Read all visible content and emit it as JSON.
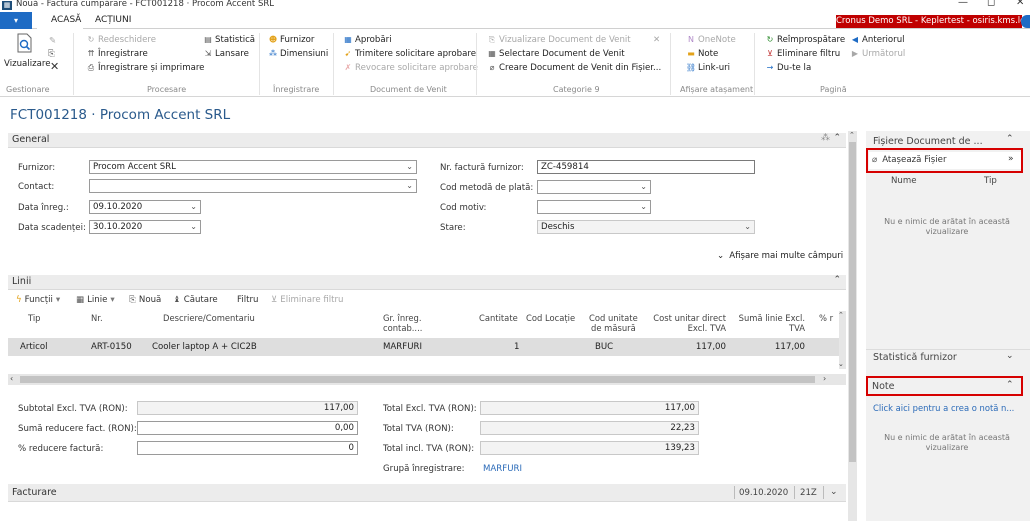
{
  "window": {
    "title": "Nouă - Factura cumpărare - FCT001218 · Procom Accent SRL",
    "app_icon_label": "nav",
    "controls": [
      "—",
      "◻",
      "✕"
    ]
  },
  "tabs": {
    "menu_icon": "chevron-down-icon",
    "items": [
      "ACASĂ",
      "ACȚIUNI"
    ],
    "company": "Cronus Demo SRL - Keplertest - osiris.kms.local"
  },
  "ribbon": {
    "groups": [
      {
        "label": "Gestionare"
      },
      {
        "label": "Procesare"
      },
      {
        "label": "Înregistrare"
      },
      {
        "label": "Document de Venit"
      },
      {
        "label": "Categorie 9"
      },
      {
        "label": "Afișare atașament"
      },
      {
        "label": "Pagină"
      }
    ],
    "vizualizare": "Vizualizare",
    "redeschidere": "Redeschidere",
    "inregistrare": "Înregistrare",
    "inregistrare_imprimare": "Înregistrare și imprimare",
    "statistica": "Statistică",
    "lansare": "Lansare",
    "furnizor": "Furnizor",
    "dimensiuni": "Dimensiuni",
    "aprobari": "Aprobări",
    "trimitere": "Trimitere solicitare aprobare",
    "revocare": "Revocare solicitare aprobare",
    "viz_doc_venit": "Vizualizare Document de Venit",
    "selectare_doc_venit": "Selectare Document de Venit",
    "creare_doc_venit": "Creare Document de Venit din Fișier...",
    "onenote": "OneNote",
    "note": "Note",
    "linkuri": "Link-uri",
    "reimprospatare": "Reîmprospătare",
    "eliminare_filtru": "Eliminare filtru",
    "du_te_la": "Du-te la",
    "anteriorul": "Anteriorul",
    "urmatorul": "Următorul"
  },
  "page": {
    "title": "FCT001218 · Procom Accent SRL"
  },
  "general": {
    "header": "General",
    "furnizor_label": "Furnizor:",
    "furnizor_value": "Procom Accent SRL",
    "contact_label": "Contact:",
    "contact_value": "",
    "data_inreg_label": "Data înreg.:",
    "data_inreg_value": "09.10.2020",
    "data_scad_label": "Data scadenței:",
    "data_scad_value": "30.10.2020",
    "nr_factura_label": "Nr. factură furnizor:",
    "nr_factura_value": "ZC-459814",
    "cod_metoda_label": "Cod metodă de plată:",
    "cod_metoda_value": "",
    "cod_motiv_label": "Cod motiv:",
    "cod_motiv_value": "",
    "stare_label": "Stare:",
    "stare_value": "Deschis",
    "show_more": "Afișare mai multe câmpuri"
  },
  "linii": {
    "header": "Linii",
    "toolbar": {
      "functii": "Funcții",
      "linie": "Linie",
      "noua": "Nouă",
      "cautare": "Căutare",
      "filtru": "Filtru",
      "eliminare_filtru": "Eliminare filtru"
    },
    "columns": {
      "tip": "Tip",
      "nr": "Nr.",
      "descriere": "Descriere/Comentariu",
      "gr_inreg_1": "Gr. înreg.",
      "gr_inreg_2": "contab....",
      "cantitate": "Cantitate",
      "cod_locatie": "Cod Locație",
      "cod_unitate_1": "Cod unitate",
      "cod_unitate_2": "de măsură",
      "cost_1": "Cost unitar direct",
      "cost_2": "Excl. TVA",
      "suma_1": "Sumă linie Excl.",
      "suma_2": "TVA",
      "pct": "% r"
    },
    "rows": [
      {
        "tip": "Articol",
        "nr": "ART-0150",
        "descriere": "Cooler laptop A + CIC2B",
        "gr_inreg": "MARFURI",
        "cantitate": "1",
        "cod_locatie": "",
        "cod_unitate": "BUC",
        "cost": "117,00",
        "suma": "117,00"
      }
    ]
  },
  "totals": {
    "subtotal_label": "Subtotal Excl. TVA (RON):",
    "subtotal_value": "117,00",
    "suma_reducere_label": "Sumă reducere fact. (RON):",
    "suma_reducere_value": "0,00",
    "pct_reducere_label": "% reducere factură:",
    "pct_reducere_value": "0",
    "total_excl_label": "Total Excl. TVA (RON):",
    "total_excl_value": "117,00",
    "total_tva_label": "Total TVA (RON):",
    "total_tva_value": "22,23",
    "total_incl_label": "Total incl. TVA (RON):",
    "total_incl_value": "139,23",
    "grupa_label": "Grupă înregistrare:",
    "grupa_value": "MARFURI"
  },
  "facturare": {
    "header": "Facturare",
    "summary_date": "09.10.2020",
    "summary_code": "21Z"
  },
  "right_panel": {
    "fisiere_header": "Fișiere Document de ...",
    "ataseaza": "Atașează Fișier",
    "col_nume": "Nume",
    "col_tip": "Tip",
    "empty_text_1": "Nu e nimic de arătat în această",
    "empty_text_2": "vizualizare",
    "statistica_header": "Statistică furnizor",
    "note_header": "Note",
    "note_link": "Click aici pentru a crea o notă n...",
    "note_empty_1": "Nu e nimic de arătat în această",
    "note_empty_2": "vizualizare"
  },
  "colors": {
    "accent": "#1e6bc4",
    "title_blue": "#2a5a8c",
    "company_red": "#c00000",
    "highlight_red": "#d60000"
  }
}
